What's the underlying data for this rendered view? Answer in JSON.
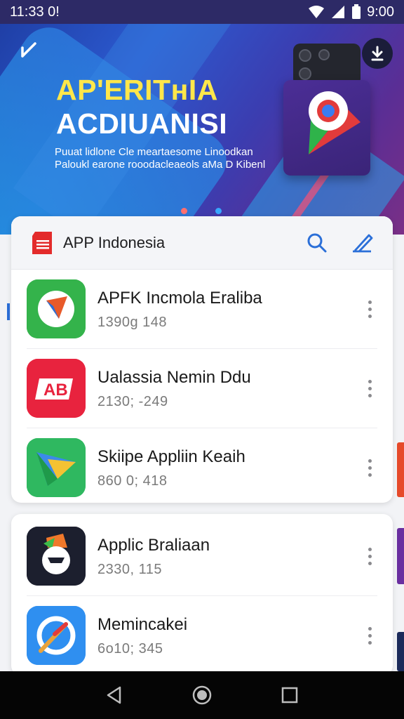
{
  "status_bar": {
    "time": "11:33 0!",
    "clock_right": "9:00"
  },
  "hero": {
    "title_line1": "AP'ERITʜIA",
    "title_line2": "ACDIUANISI",
    "subtitle": "Puuat lidlone Cle meartaesome Linoodkan Paloukl earone rooodacleaeols aMa D Kibenl"
  },
  "store": {
    "title": "APP Indonesia",
    "accent_color": "#2b6fd8"
  },
  "apps_card1": [
    {
      "name": "APFK Incmola Eraliba",
      "meta": "1390g  148",
      "icon": "compass-app-icon"
    },
    {
      "name": "Ualassia Nemin Ddu",
      "meta": "2130; -249",
      "icon": "ab-app-icon"
    },
    {
      "name": "Skiipe Appliin Keaih",
      "meta": "860 0; 418",
      "icon": "play-app-icon"
    }
  ],
  "apps_card2": [
    {
      "name": "Applic Braliaan",
      "meta": "2330, 115",
      "icon": "mascot-app-icon"
    },
    {
      "name": "Memincakei",
      "meta": "6o10; 345",
      "icon": "compass-blue-app-icon"
    }
  ]
}
